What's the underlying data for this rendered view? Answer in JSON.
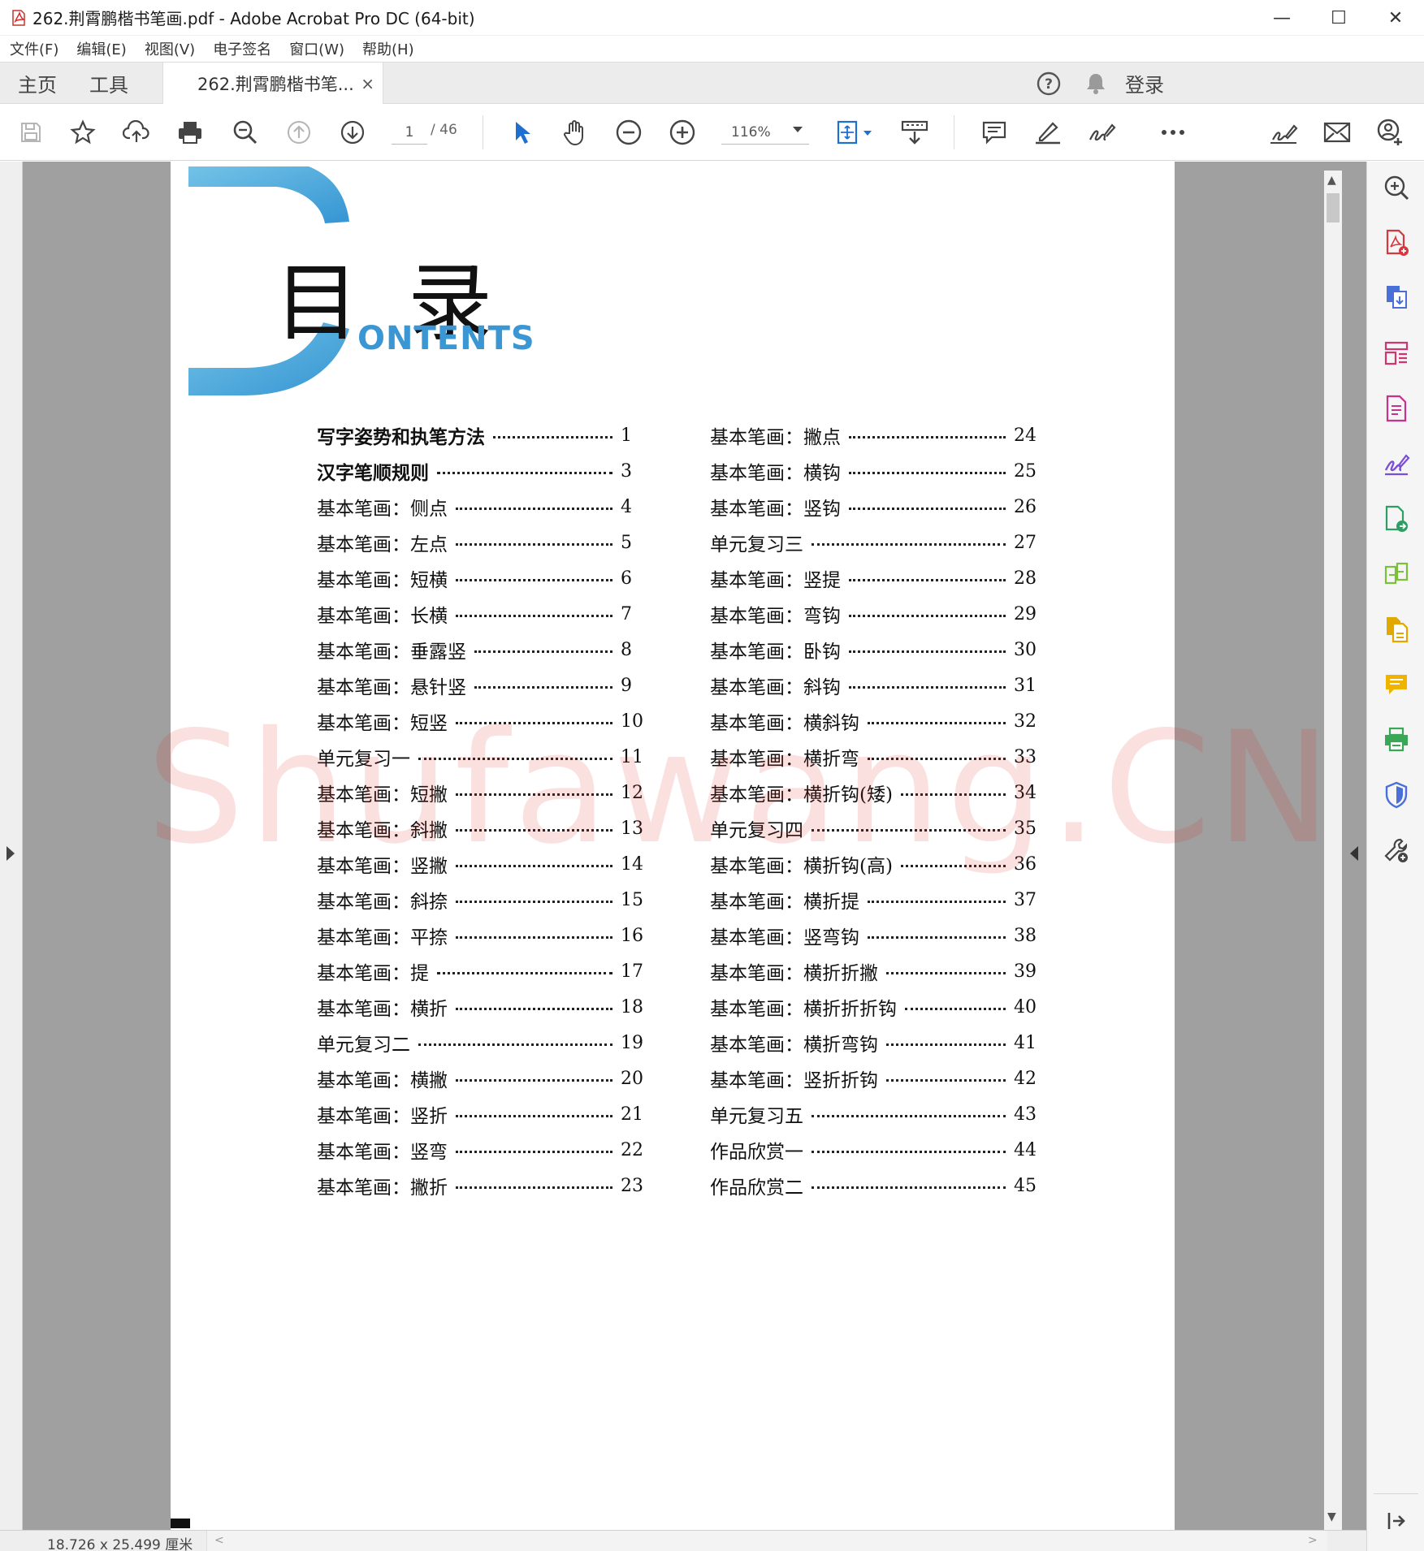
{
  "window": {
    "title": "262.荆霄鹏楷书笔画.pdf - Adobe Acrobat Pro DC (64-bit)",
    "minimize": "—",
    "maximize": "☐",
    "close": "✕"
  },
  "menu": [
    "文件(F)",
    "编辑(E)",
    "视图(V)",
    "电子签名",
    "窗口(W)",
    "帮助(H)"
  ],
  "tabs": {
    "home": "主页",
    "tools": "工具",
    "document": "262.荆霄鹏楷书笔...",
    "close": "×"
  },
  "header_right": {
    "help_icon": "help-icon",
    "bell_icon": "bell-icon",
    "login": "登录"
  },
  "toolbar": {
    "page_current": "1",
    "page_total": "/ 46",
    "zoom": "116%",
    "icons": [
      "save-icon",
      "star-icon",
      "upload-icon",
      "print-icon",
      "search-icon",
      "prev-page-icon",
      "next-page-icon",
      "select-cursor-icon",
      "hand-icon",
      "zoom-out-icon",
      "zoom-in-icon",
      "fit-page-icon",
      "scroll-mode-icon",
      "comment-icon",
      "highlight-icon",
      "sign-icon",
      "more-icon",
      "share-link-icon",
      "email-icon",
      "add-user-icon"
    ]
  },
  "document": {
    "heading_cn": "目录",
    "heading_en": "ONTENTS",
    "watermark": "Shufawang.CN",
    "toc_left": [
      {
        "title": "写字姿势和执笔方法",
        "page": "1",
        "bold": true
      },
      {
        "title": "汉字笔顺规则",
        "page": "3",
        "bold": true
      },
      {
        "title": "基本笔画：侧点",
        "page": "4"
      },
      {
        "title": "基本笔画：左点",
        "page": "5"
      },
      {
        "title": "基本笔画：短横",
        "page": "6"
      },
      {
        "title": "基本笔画：长横",
        "page": "7"
      },
      {
        "title": "基本笔画：垂露竖",
        "page": "8"
      },
      {
        "title": "基本笔画：悬针竖",
        "page": "9"
      },
      {
        "title": "基本笔画：短竖",
        "page": "10"
      },
      {
        "title": "单元复习一",
        "page": "11"
      },
      {
        "title": "基本笔画：短撇",
        "page": "12"
      },
      {
        "title": "基本笔画：斜撇",
        "page": "13"
      },
      {
        "title": "基本笔画：竖撇",
        "page": "14"
      },
      {
        "title": "基本笔画：斜捺",
        "page": "15"
      },
      {
        "title": "基本笔画：平捺",
        "page": "16"
      },
      {
        "title": "基本笔画：提",
        "page": "17"
      },
      {
        "title": "基本笔画：横折",
        "page": "18"
      },
      {
        "title": "单元复习二",
        "page": "19"
      },
      {
        "title": "基本笔画：横撇",
        "page": "20"
      },
      {
        "title": "基本笔画：竖折",
        "page": "21"
      },
      {
        "title": "基本笔画：竖弯",
        "page": "22"
      },
      {
        "title": "基本笔画：撇折",
        "page": "23"
      }
    ],
    "toc_right": [
      {
        "title": "基本笔画：撇点",
        "page": "24"
      },
      {
        "title": "基本笔画：横钩",
        "page": "25"
      },
      {
        "title": "基本笔画：竖钩",
        "page": "26"
      },
      {
        "title": "单元复习三",
        "page": "27"
      },
      {
        "title": "基本笔画：竖提",
        "page": "28"
      },
      {
        "title": "基本笔画：弯钩",
        "page": "29"
      },
      {
        "title": "基本笔画：卧钩",
        "page": "30"
      },
      {
        "title": "基本笔画：斜钩",
        "page": "31"
      },
      {
        "title": "基本笔画：横斜钩",
        "page": "32"
      },
      {
        "title": "基本笔画：横折弯",
        "page": "33"
      },
      {
        "title": "基本笔画：横折钩(矮)",
        "page": "34"
      },
      {
        "title": "单元复习四",
        "page": "35"
      },
      {
        "title": "基本笔画：横折钩(高)",
        "page": "36"
      },
      {
        "title": "基本笔画：横折提",
        "page": "37"
      },
      {
        "title": "基本笔画：竖弯钩",
        "page": "38"
      },
      {
        "title": "基本笔画：横折折撇",
        "page": "39"
      },
      {
        "title": "基本笔画：横折折折钩",
        "page": "40"
      },
      {
        "title": "基本笔画：横折弯钩",
        "page": "41"
      },
      {
        "title": "基本笔画：竖折折钩",
        "page": "42"
      },
      {
        "title": "单元复习五",
        "page": "43"
      },
      {
        "title": "作品欣赏一",
        "page": "44"
      },
      {
        "title": "作品欣赏二",
        "page": "45"
      }
    ]
  },
  "status": {
    "page_size": "18.726 x 25.499 厘米"
  },
  "colors": {
    "accent_blue": "#3a97d4",
    "watermark_red": "#dc281e",
    "pane_magenta": "#c8338a",
    "pane_purple": "#7a4fd6",
    "pane_green": "#3aa757",
    "pane_yellow": "#e0a800",
    "pane_blue": "#1f6fd1"
  }
}
